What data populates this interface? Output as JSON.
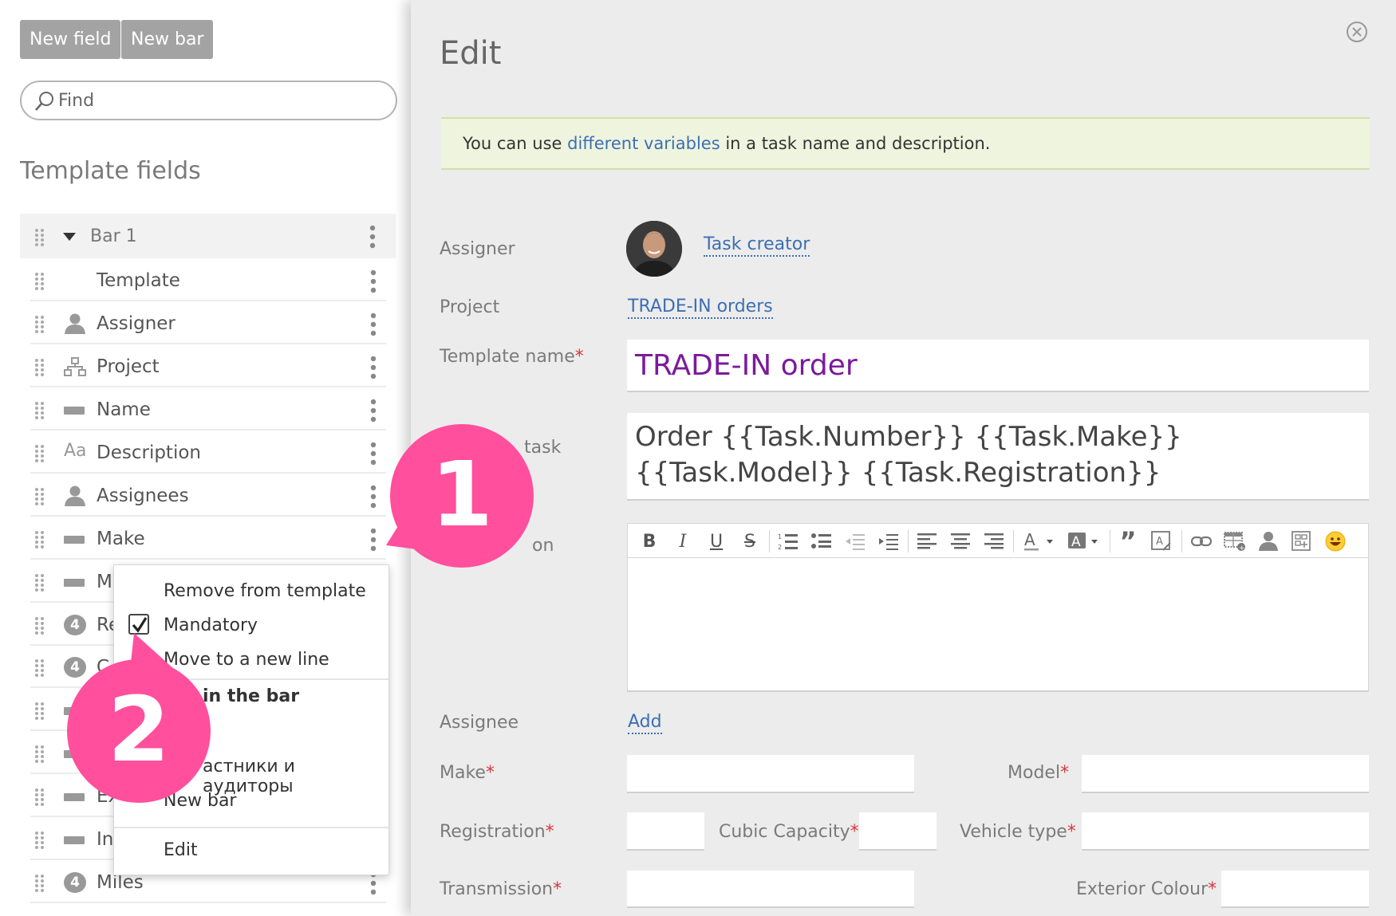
{
  "toolbar": {
    "new_field": "New field",
    "new_bar": "New bar"
  },
  "search": {
    "placeholder": "Find"
  },
  "left": {
    "title": "Template fields",
    "bar_label": "Bar 1",
    "fields": [
      {
        "label": "Template",
        "icon": "none"
      },
      {
        "label": "Assigner",
        "icon": "person-icon"
      },
      {
        "label": "Project",
        "icon": "hierarchy-icon"
      },
      {
        "label": "Name",
        "icon": "string-field-icon"
      },
      {
        "label": "Description",
        "icon": "text-field-icon"
      },
      {
        "label": "Assignees",
        "icon": "person-icon"
      },
      {
        "label": "Make",
        "icon": "string-field-icon"
      },
      {
        "label": "M",
        "icon": "string-field-icon"
      },
      {
        "label": "Re",
        "icon": "number-field-icon"
      },
      {
        "label": "C",
        "icon": "number-field-icon"
      },
      {
        "label": "",
        "icon": "string-field-icon"
      },
      {
        "label": "",
        "icon": "string-field-icon"
      },
      {
        "label": "Ex",
        "icon": "string-field-icon"
      },
      {
        "label": "In",
        "icon": "string-field-icon"
      },
      {
        "label": "Miles",
        "icon": "number-field-icon"
      }
    ],
    "text_icon_glyph": "Aa",
    "number_icon_glyph": "4"
  },
  "context_menu": {
    "items": {
      "remove": "Remove from template",
      "mandatory": "Mandatory",
      "move_line": "Move to a new line",
      "in_bar": "in the bar",
      "participants": "астники и аудиторы",
      "new_bar": "New bar",
      "edit": "Edit"
    },
    "mandatory_checked": true
  },
  "edit": {
    "title": "Edit",
    "notice": {
      "before": "You can use ",
      "link": "different variables",
      "after": " in a task name and description."
    },
    "fields": {
      "assigner_label": "Assigner",
      "assigner_value": "Task creator",
      "project_label": "Project",
      "project_value": "TRADE-IN orders",
      "template_name_label": "Template name",
      "template_name_value": "TRADE-IN order",
      "task_label_fragment": "task",
      "task_name_value": "Order {{Task.Number}} {{Task.Make}} {{Task.Model}} {{Task.Registration}}",
      "description_label_fragment": "on",
      "assignee_label": "Assignee",
      "assignee_value": "Add",
      "make_label": "Make",
      "model_label": "Model",
      "registration_label": "Registration",
      "cubic_label": "Cubic Capacity",
      "vehicle_label": "Vehicle type",
      "transmission_label": "Transmission",
      "exterior_label": "Exterior Colour",
      "required_mark": "*"
    }
  },
  "callouts": {
    "one": "1",
    "two": "2"
  },
  "colors": {
    "accent_link": "#3c6fb4",
    "callout": "#ff4f9d",
    "template_name": "#7b1a9c",
    "required": "#d9363e"
  }
}
